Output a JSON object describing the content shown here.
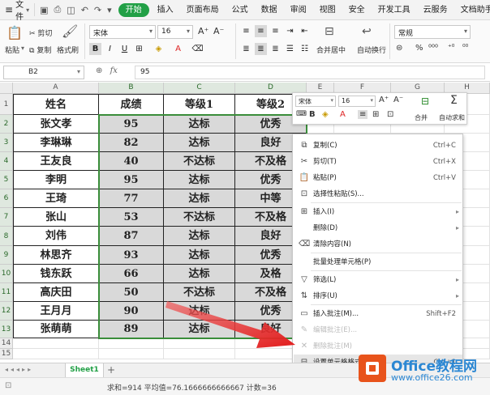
{
  "menubar": {
    "file": "文件",
    "tabs": [
      "开始",
      "插入",
      "页面布局",
      "公式",
      "数据",
      "审阅",
      "视图",
      "安全",
      "开发工具",
      "云服务",
      "文档助手"
    ],
    "active_tab": "开始",
    "accent": "#22a046"
  },
  "ribbon": {
    "paste": "粘贴",
    "cut": "剪切",
    "copy": "复制",
    "format_painter": "格式刷",
    "font_name": "宋体",
    "font_size": "16",
    "merge_center": "合并居中",
    "wrap_text": "自动换行",
    "number_format": "常规"
  },
  "formula_bar": {
    "name_box": "B2",
    "fx": "fx",
    "value": "95"
  },
  "sheet": {
    "columns": [
      "A",
      "B",
      "C",
      "D",
      "E",
      "F",
      "G",
      "H"
    ],
    "rows": [
      "1",
      "2",
      "3",
      "4",
      "5",
      "6",
      "7",
      "8",
      "9",
      "10",
      "11",
      "12",
      "13",
      "14",
      "15"
    ],
    "header": [
      "姓名",
      "成绩",
      "等级1",
      "等级2"
    ],
    "data": [
      [
        "张文孝",
        "95",
        "达标",
        "优秀"
      ],
      [
        "李琳琳",
        "82",
        "达标",
        "良好"
      ],
      [
        "王友良",
        "40",
        "不达标",
        "不及格"
      ],
      [
        "李明",
        "95",
        "达标",
        "优秀"
      ],
      [
        "王琦",
        "77",
        "达标",
        "中等"
      ],
      [
        "张山",
        "53",
        "不达标",
        "不及格"
      ],
      [
        "刘伟",
        "87",
        "达标",
        "良好"
      ],
      [
        "林思齐",
        "93",
        "达标",
        "优秀"
      ],
      [
        "钱东跃",
        "66",
        "达标",
        "及格"
      ],
      [
        "高庆田",
        "50",
        "不达标",
        "不及格"
      ],
      [
        "王月月",
        "90",
        "达标",
        "优秀"
      ],
      [
        "张萌萌",
        "89",
        "达标",
        "良好"
      ]
    ]
  },
  "mini_toolbar": {
    "font_name": "宋体",
    "font_size": "16",
    "merge": "合并",
    "autosum": "自动求和"
  },
  "context_menu": [
    {
      "label": "复制(C)",
      "shortcut": "Ctrl+C",
      "icon": "copy-icon"
    },
    {
      "label": "剪切(T)",
      "shortcut": "Ctrl+X",
      "icon": "cut-icon"
    },
    {
      "label": "粘贴(P)",
      "shortcut": "Ctrl+V",
      "icon": "paste-icon"
    },
    {
      "label": "选择性粘贴(S)...",
      "shortcut": "",
      "icon": "paste-special-icon"
    },
    {
      "label": "插入(I)",
      "shortcut": "",
      "icon": "insert-icon"
    },
    {
      "label": "删除(D)",
      "shortcut": "",
      "icon": ""
    },
    {
      "label": "清除内容(N)",
      "shortcut": "",
      "icon": "clear-icon"
    },
    {
      "label": "批量处理单元格(P)",
      "shortcut": "",
      "icon": ""
    },
    {
      "label": "筛选(L)",
      "shortcut": "",
      "icon": "filter-icon"
    },
    {
      "label": "排序(U)",
      "shortcut": "",
      "icon": "sort-icon"
    },
    {
      "label": "插入批注(M)...",
      "shortcut": "Shift+F2",
      "icon": "comment-icon"
    },
    {
      "label": "编辑批注(E)...",
      "shortcut": "",
      "icon": "edit-comment-icon"
    },
    {
      "label": "删除批注(M)",
      "shortcut": "",
      "icon": "delete-comment-icon"
    },
    {
      "label": "设置单元格格式(F)...",
      "shortcut": "Ctrl+1",
      "icon": "format-cells-icon"
    },
    {
      "label": "从下拉列表中选",
      "shortcut": "",
      "icon": ""
    }
  ],
  "sheet_tab": "Sheet1",
  "status": "求和=914  平均值=76.1666666666667  计数=36",
  "watermark": {
    "title": "Office教程网",
    "url": "www.office26.com"
  }
}
